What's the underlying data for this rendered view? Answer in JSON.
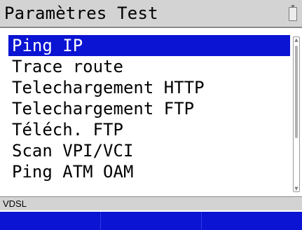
{
  "header": {
    "title": "Paramètres Test",
    "battery_icon": "battery-icon"
  },
  "menu": {
    "items": [
      {
        "label": "Ping IP",
        "selected": true
      },
      {
        "label": "Trace route",
        "selected": false
      },
      {
        "label": "Telechargement HTTP",
        "selected": false
      },
      {
        "label": "Telechargement FTP",
        "selected": false
      },
      {
        "label": "Téléch. FTP",
        "selected": false
      },
      {
        "label": "Scan VPI/VCI",
        "selected": false
      },
      {
        "label": "Ping ATM OAM",
        "selected": false
      }
    ],
    "selection_color": "#0a14d2"
  },
  "scrollbar": {
    "up_icon": "scroll-up-arrow-icon",
    "down_icon": "scroll-down-arrow-icon"
  },
  "status": {
    "text": "VDSL"
  },
  "softkeys": {
    "items": [
      {
        "label": ""
      },
      {
        "label": ""
      },
      {
        "label": ""
      }
    ],
    "color": "#0a14d2"
  }
}
